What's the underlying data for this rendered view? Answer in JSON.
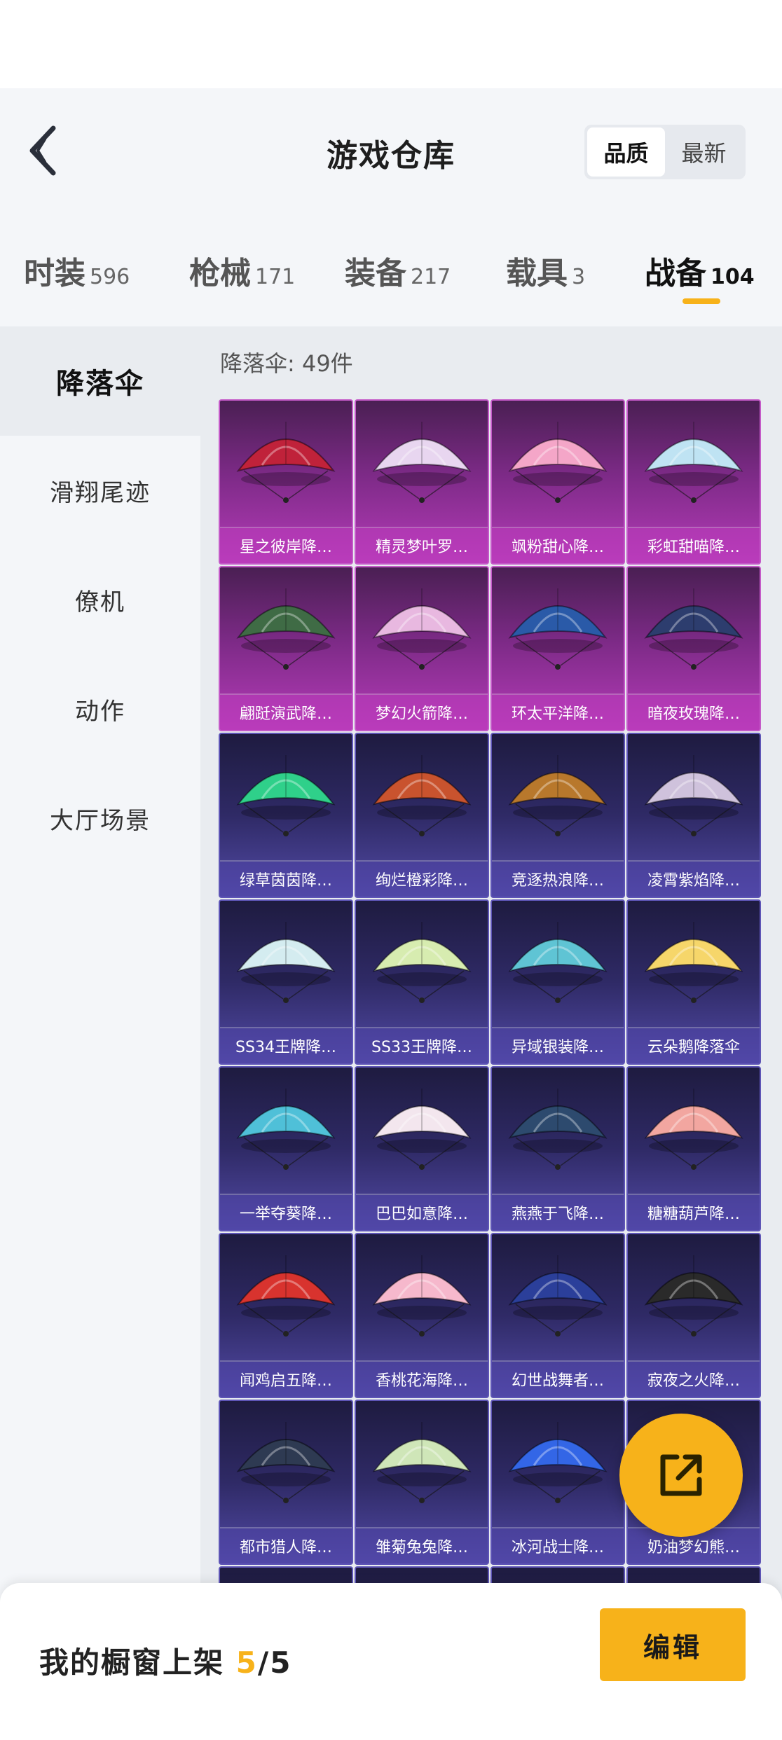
{
  "header": {
    "title": "游戏仓库",
    "sort_options": [
      "品质",
      "最新"
    ]
  },
  "tabs": [
    {
      "label": "时装",
      "count": "596"
    },
    {
      "label": "枪械",
      "count": "171"
    },
    {
      "label": "装备",
      "count": "217"
    },
    {
      "label": "载具",
      "count": "3"
    },
    {
      "label": "战备",
      "count": "104"
    }
  ],
  "sidebar": {
    "items": [
      "降落伞",
      "滑翔尾迹",
      "僚机",
      "动作",
      "大厅场景"
    ]
  },
  "main": {
    "count_label": "降落伞: 49件",
    "items": [
      {
        "name": "星之彼岸降…",
        "rarity": "legendary",
        "color": "#c0223a"
      },
      {
        "name": "精灵梦叶罗…",
        "rarity": "legendary",
        "color": "#e8d6f0"
      },
      {
        "name": "飒粉甜心降…",
        "rarity": "legendary",
        "color": "#f4a6c8"
      },
      {
        "name": "彩虹甜喵降…",
        "rarity": "legendary",
        "color": "#bfe3f3"
      },
      {
        "name": "翩跹演武降…",
        "rarity": "legendary",
        "color": "#3f6b45"
      },
      {
        "name": "梦幻火箭降…",
        "rarity": "legendary",
        "color": "#e8b8e0"
      },
      {
        "name": "环太平洋降…",
        "rarity": "legendary",
        "color": "#2a5aa8"
      },
      {
        "name": "暗夜玫瑰降…",
        "rarity": "legendary",
        "color": "#2d3d6e"
      },
      {
        "name": "绿草茵茵降…",
        "rarity": "epic",
        "color": "#2fd08a"
      },
      {
        "name": "绚烂橙彩降…",
        "rarity": "epic",
        "color": "#c9532e"
      },
      {
        "name": "竞逐热浪降…",
        "rarity": "epic",
        "color": "#b8782c"
      },
      {
        "name": "凌霄紫焰降…",
        "rarity": "epic",
        "color": "#cfc2dc"
      },
      {
        "name": "SS34王牌降…",
        "rarity": "epic",
        "color": "#d4ecf0"
      },
      {
        "name": "SS33王牌降…",
        "rarity": "epic",
        "color": "#d7ecb0"
      },
      {
        "name": "异域银装降…",
        "rarity": "epic",
        "color": "#5fc4d4"
      },
      {
        "name": "云朵鹅降落伞",
        "rarity": "epic",
        "color": "#f6d66a"
      },
      {
        "name": "一举夺葵降…",
        "rarity": "epic",
        "color": "#4fc0d8"
      },
      {
        "name": "巴巴如意降…",
        "rarity": "epic",
        "color": "#f3e6ee"
      },
      {
        "name": "燕燕于飞降…",
        "rarity": "epic",
        "color": "#2d4a6e"
      },
      {
        "name": "糖糖葫芦降…",
        "rarity": "epic",
        "color": "#f2a6a0"
      },
      {
        "name": "闻鸡启五降…",
        "rarity": "epic",
        "color": "#d8332e"
      },
      {
        "name": "香桃花海降…",
        "rarity": "epic",
        "color": "#f6b8cc"
      },
      {
        "name": "幻世战舞者…",
        "rarity": "epic",
        "color": "#2b3f9a"
      },
      {
        "name": "寂夜之火降…",
        "rarity": "epic",
        "color": "#2a2a2a"
      },
      {
        "name": "都市猎人降…",
        "rarity": "epic",
        "color": "#2e3a52"
      },
      {
        "name": "雏菊兔兔降…",
        "rarity": "epic",
        "color": "#cfe6b8"
      },
      {
        "name": "冰河战士降…",
        "rarity": "epic",
        "color": "#3366e6"
      },
      {
        "name": "奶油梦幻熊…",
        "rarity": "epic",
        "color": "#f3e8d8"
      }
    ]
  },
  "footer": {
    "label": "我的橱窗上架",
    "current": "5",
    "total": "/5",
    "edit_label": "编辑"
  },
  "colors": {
    "accent": "#f7b21a",
    "legendary": "#b53bb8",
    "epic": "#524aa6"
  },
  "icons": {
    "back": "chevron-left-icon",
    "share": "external-link-icon"
  }
}
